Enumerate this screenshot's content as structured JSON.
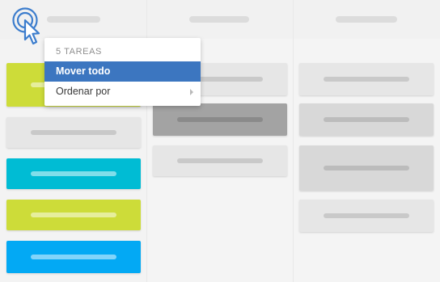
{
  "menu": {
    "header": "5 TAREAS",
    "items": [
      {
        "label": "Mover todo",
        "active": true
      },
      {
        "label": "Ordenar por",
        "has_submenu": true
      }
    ]
  },
  "colors": {
    "menu_active": "#3c76c0",
    "card_lime": "#cddc39",
    "card_cyan": "#00bcd4",
    "card_blue": "#03a9f4",
    "card_light": "#e6e6e6",
    "card_dark": "#a3a3a3",
    "card_gray": "#d8d8d8",
    "cursor": "#3c7dcd"
  },
  "icons": {
    "cursor": "click-cursor-icon",
    "submenu": "chevron-right-icon"
  }
}
